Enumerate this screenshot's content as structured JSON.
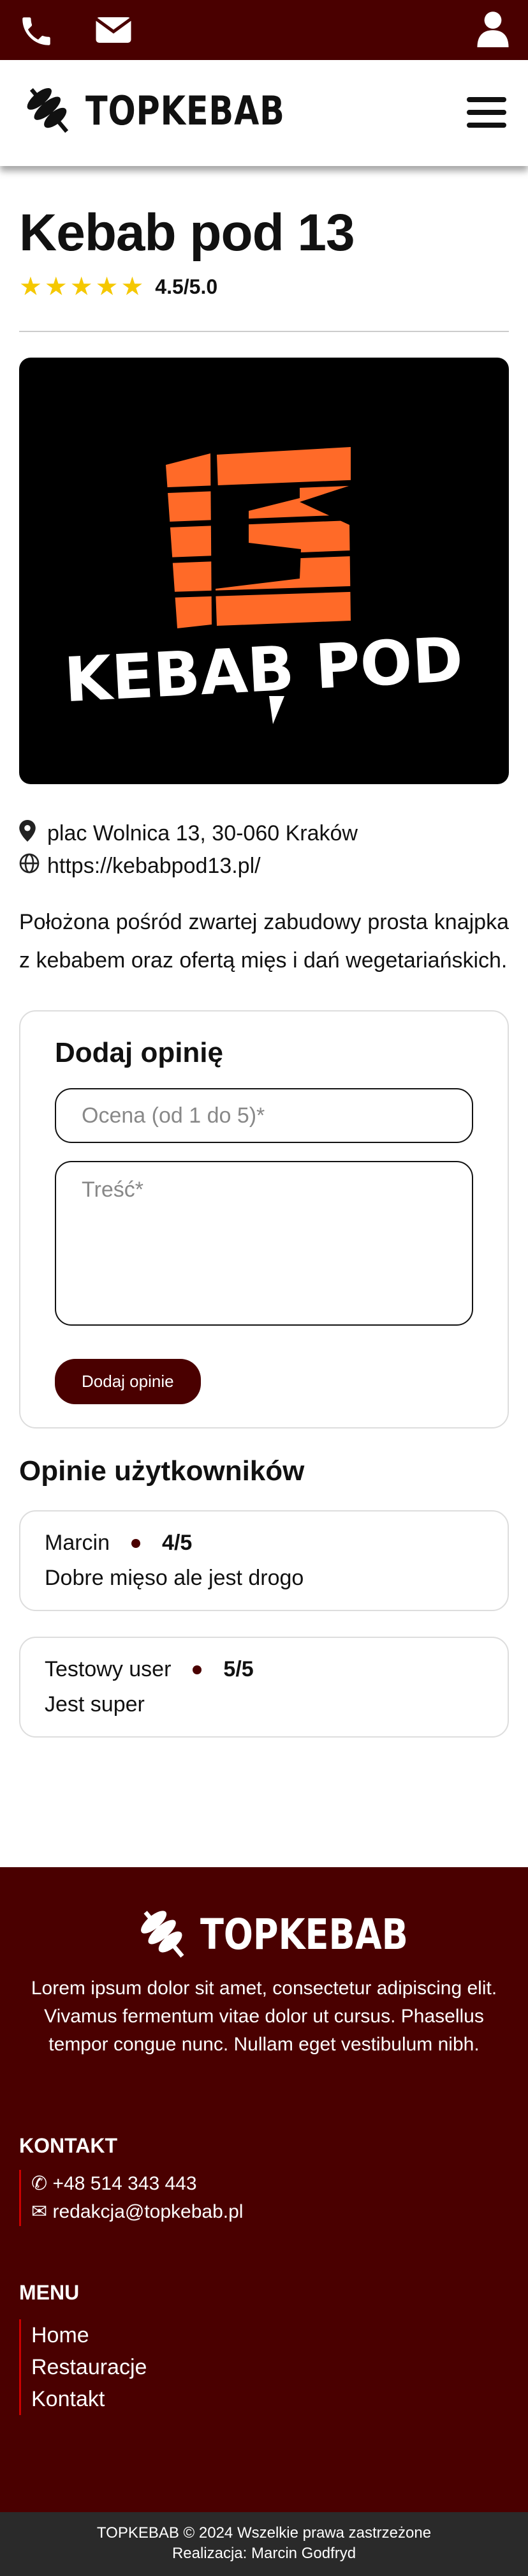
{
  "brand": {
    "name": "TOPKEBAB"
  },
  "page": {
    "title": "Kebab pod 13",
    "rating_stars": "★★★★★",
    "rating_text": "4.5/5.0",
    "logo_text": "KEBAB POD",
    "logo_number": "13",
    "address": "plac Wolnica 13, 30-060 Kraków",
    "website": "https://kebabpod13.pl/",
    "description": "Położona pośród zwartej zabudowy prosta knajpka z kebabem oraz ofertą mięs i dań wegetariańskich."
  },
  "review_form": {
    "title": "Dodaj opinię",
    "rating_placeholder": "Ocena (od 1 do 5)*",
    "content_placeholder": "Treść*",
    "submit_label": "Dodaj opinie"
  },
  "reviews": {
    "title": "Opinie użytkowników",
    "items": [
      {
        "author": "Marcin",
        "score": "4/5",
        "text": "Dobre mięso ale jest drogo"
      },
      {
        "author": "Testowy user",
        "score": "5/5",
        "text": "Jest super"
      }
    ]
  },
  "footer": {
    "description": "Lorem ipsum dolor sit amet, consectetur adipiscing elit. Vivamus fermentum vitae dolor ut cursus. Phasellus tempor congue nunc. Nullam eget vestibulum nibh.",
    "contact_title": "KONTAKT",
    "phone": "+48 514 343 443",
    "email": "redakcja@topkebab.pl",
    "menu_title": "MENU",
    "menu": [
      "Home",
      "Restauracje",
      "Kontakt"
    ],
    "copyright": "TOPKEBAB © 2024 Wszelkie prawa zastrzeżone",
    "credit": "Realizacja: Marcin Godfryd"
  },
  "icons": [
    "phone-icon",
    "envelope-icon",
    "user-icon",
    "menu-icon",
    "map-pin-icon",
    "globe-icon",
    "star-icon"
  ],
  "colors": {
    "primary": "#4a0000",
    "star": "#f5c800",
    "logo_orange": "#ff6a28",
    "bottom_bar": "#2a2a2a"
  }
}
